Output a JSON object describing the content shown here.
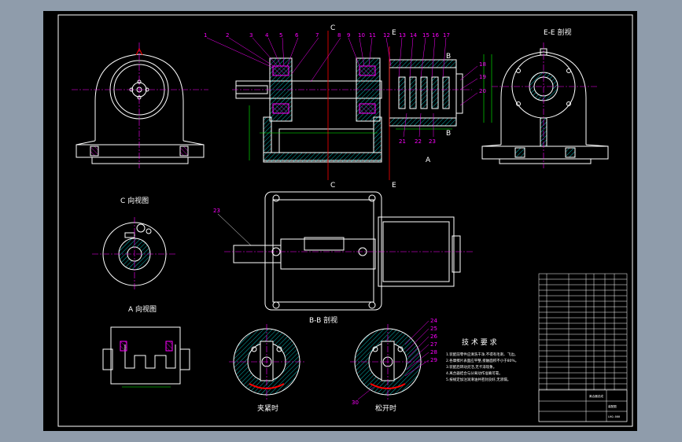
{
  "views": {
    "section_ee": "E-E 剖视",
    "view_c": "C 向视图",
    "view_a": "A 向视图",
    "section_bb": "B-B 剖视",
    "engaged_pos": "夹紧时",
    "released_pos": "松开时"
  },
  "markers": {
    "c_top": "C",
    "c_bottom": "C",
    "e_top": "E",
    "e_bottom": "E",
    "b_top": "B",
    "b_bottom": "B",
    "a_arrow": "A"
  },
  "balloons_top": [
    "1",
    "2",
    "3",
    "4",
    "5",
    "6",
    "7",
    "8",
    "9",
    "10",
    "11",
    "12",
    "13",
    "14",
    "15",
    "16",
    "17"
  ],
  "balloons_right": [
    "18",
    "19",
    "20"
  ],
  "balloons_bottom": [
    "21",
    "22",
    "23"
  ],
  "balloon_23": "23",
  "balloons_release": [
    "24",
    "25",
    "26",
    "27",
    "28",
    "29"
  ],
  "balloon_30": "30",
  "tech_title": "技 术 要 求",
  "tech_notes": [
    "1.装配前零件应清洗干净,不得有毛刺、飞边。",
    "2.各摩擦片表面应平整,接触面积不小于80%。",
    "3.装配后转动灵活,无卡滞现象。",
    "4.离合器结合与分离动作准确可靠。",
    "5.按规定加注润滑油并密封良好,无渗漏。"
  ],
  "title_block": {
    "drawing_name": "离合器总成",
    "label": "装配图",
    "code": "LHQ-000"
  },
  "colors": {
    "frame": "#ffffff",
    "outline": "#ffffff",
    "center": "#ff00ff",
    "dim": "#00ff00",
    "hatch": "#00ffff",
    "hidden": "#ffff00",
    "cut": "#ff0000"
  }
}
